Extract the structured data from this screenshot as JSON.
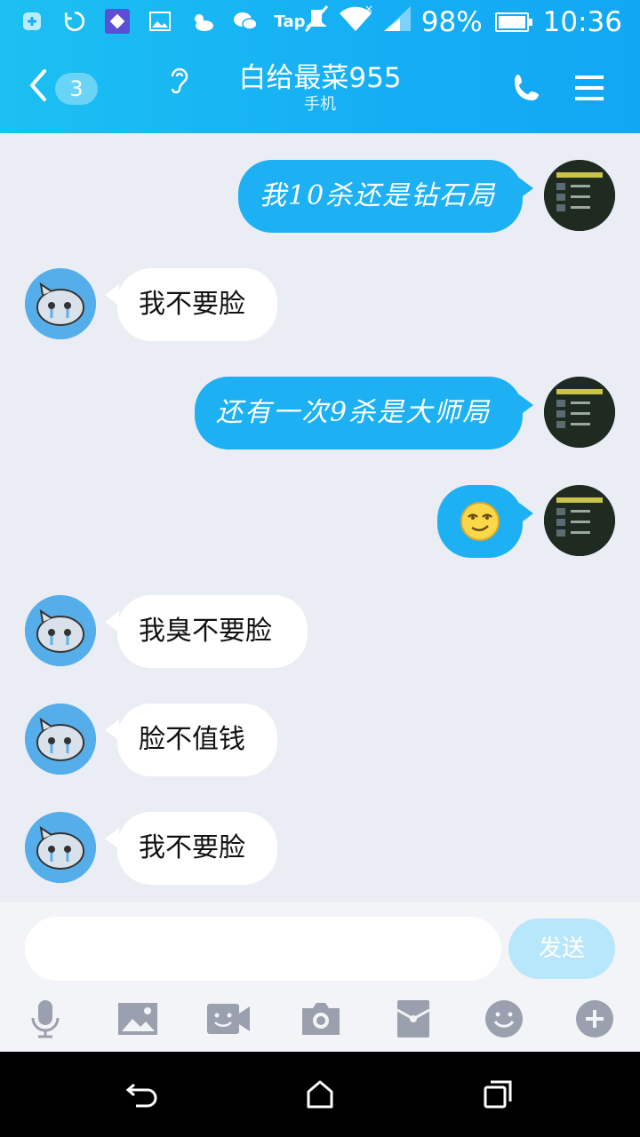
{
  "status_bar": {
    "icons": [
      "plus-badge-icon",
      "sync-icon",
      "app-icon",
      "image-icon",
      "weather-icon",
      "wechat-icon",
      "tap-icon",
      "mute-icon",
      "wifi-icon",
      "signal-icon"
    ],
    "tap_label": "Tap",
    "battery": "98%",
    "time": "10:36"
  },
  "header": {
    "back_icon": "chevron-left-icon",
    "unread_count": "3",
    "title": "白给最菜955",
    "subtitle": "手机",
    "phone_icon": "phone-icon",
    "menu_icon": "menu-icon"
  },
  "messages": [
    {
      "from": "self",
      "text": "我10杀还是钻石局"
    },
    {
      "from": "other",
      "text": "我不要脸"
    },
    {
      "from": "self",
      "text": "还有一次9杀是大师局"
    },
    {
      "from": "self",
      "emoji": "smirk-emoji"
    },
    {
      "from": "other",
      "text": "我臭不要脸"
    },
    {
      "from": "other",
      "text": "脸不值钱"
    },
    {
      "from": "other",
      "text": "我不要脸"
    }
  ],
  "composer": {
    "placeholder": "",
    "send_label": "发送"
  },
  "toolbar": [
    "microphone-icon",
    "image-icon",
    "video-call-icon",
    "camera-icon",
    "red-packet-icon",
    "emoji-icon",
    "plus-icon"
  ],
  "navbar": [
    "back-icon",
    "home-icon",
    "recents-icon"
  ],
  "colors": {
    "header": "#15aef4",
    "bubble_self": "#1db1f3",
    "bubble_other": "#ffffff",
    "chat_background": "#eaedf4",
    "send_disabled": "#b8e7fb"
  }
}
